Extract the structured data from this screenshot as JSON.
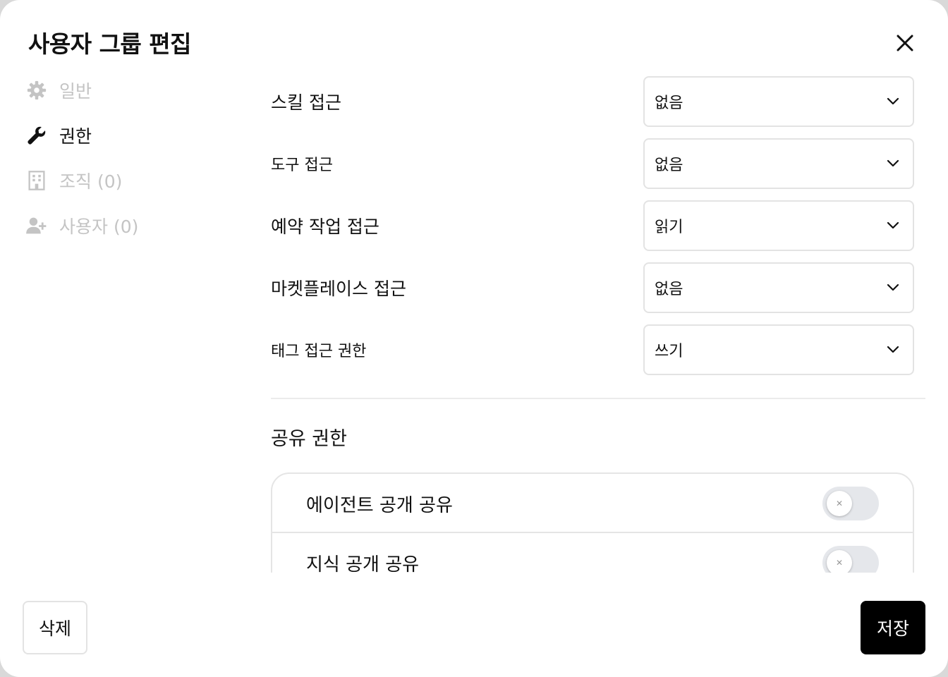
{
  "dialog": {
    "title": "사용자 그룹 편집",
    "close_icon": "close-icon"
  },
  "sidebar": {
    "items": [
      {
        "label": "일반",
        "icon": "gear-icon",
        "active": false
      },
      {
        "label": "권한",
        "icon": "wrench-icon",
        "active": true
      },
      {
        "label": "조직 (0)",
        "icon": "building-icon",
        "active": false
      },
      {
        "label": "사용자 (0)",
        "icon": "user-plus-icon",
        "active": false
      }
    ]
  },
  "permissions": [
    {
      "label": "스킬 접근",
      "value": "없음"
    },
    {
      "label": "도구 접근",
      "value": "없음"
    },
    {
      "label": "예약 작업 접근",
      "value": "읽기"
    },
    {
      "label": "마켓플레이스 접근",
      "value": "없음"
    },
    {
      "label": "태그 접근 권한",
      "value": "쓰기"
    }
  ],
  "sharing": {
    "title": "공유 권한",
    "items": [
      {
        "label": "에이전트 공개 공유",
        "enabled": false
      },
      {
        "label": "지식 공개 공유",
        "enabled": false
      }
    ]
  },
  "footer": {
    "delete_label": "삭제",
    "save_label": "저장"
  },
  "colors": {
    "primary_button": "#000000",
    "toggle_off": "#e5e7eb",
    "inactive_nav": "#c4c4c4"
  }
}
